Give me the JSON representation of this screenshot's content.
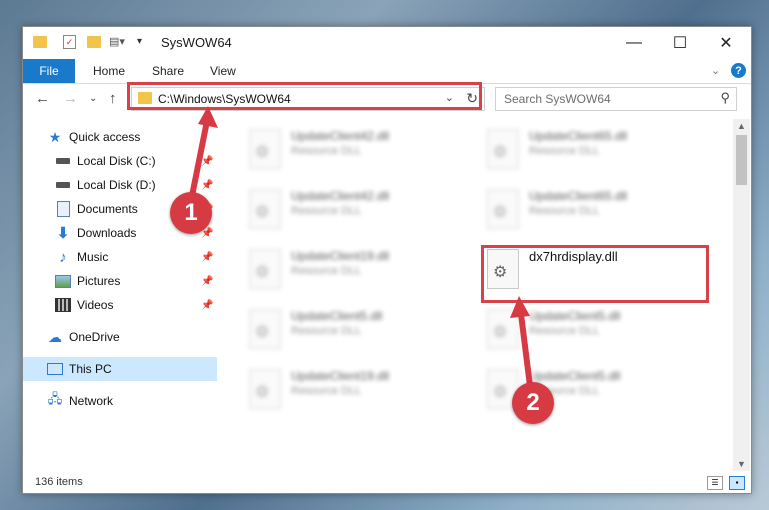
{
  "window": {
    "title": "SysWOW64",
    "controls": {
      "minimize": "—",
      "maximize": "☐",
      "close": "✕"
    }
  },
  "ribbon": {
    "file": "File",
    "tabs": [
      "Home",
      "Share",
      "View"
    ]
  },
  "address": {
    "path": "C:\\Windows\\SysWOW64",
    "search_placeholder": "Search SysWOW64"
  },
  "sidebar": {
    "items": [
      {
        "label": "Quick access",
        "icon": "star-icon"
      },
      {
        "label": "Local Disk (C:)",
        "icon": "drive-icon"
      },
      {
        "label": "Local Disk (D:)",
        "icon": "drive-icon"
      },
      {
        "label": "Documents",
        "icon": "documents-icon"
      },
      {
        "label": "Downloads",
        "icon": "download-icon"
      },
      {
        "label": "Music",
        "icon": "music-icon"
      },
      {
        "label": "Pictures",
        "icon": "pictures-icon"
      },
      {
        "label": "Videos",
        "icon": "videos-icon"
      },
      {
        "label": "OneDrive",
        "icon": "cloud-icon"
      },
      {
        "label": "This PC",
        "icon": "computer-icon"
      },
      {
        "label": "Network",
        "icon": "network-icon"
      }
    ],
    "selected": "This PC"
  },
  "files": {
    "items": [
      {
        "name": "UpdateClient42.dll",
        "desc": "Resource DLL",
        "blurred": true
      },
      {
        "name": "UpdateClient65.dll",
        "desc": "Resource DLL",
        "blurred": true
      },
      {
        "name": "UpdateClient42.dll",
        "desc": "Resource DLL",
        "blurred": true
      },
      {
        "name": "UpdateClient65.dll",
        "desc": "Resource DLL",
        "blurred": true
      },
      {
        "name": "UpdateClient19.dll",
        "desc": "Resource DLL",
        "blurred": true
      },
      {
        "name": "dx7hrdisplay.dll",
        "desc": "",
        "blurred": false
      },
      {
        "name": "UpdateClient5.dll",
        "desc": "Resource DLL",
        "blurred": true
      },
      {
        "name": "UpdateClient5.dll",
        "desc": "Resource DLL",
        "blurred": true
      },
      {
        "name": "UpdateClient19.dll",
        "desc": "Resource DLL",
        "blurred": true
      },
      {
        "name": "UpdateClient5.dll",
        "desc": "Resource DLL",
        "blurred": true
      }
    ]
  },
  "status": {
    "count": "136 items"
  },
  "callouts": {
    "first": "1",
    "second": "2"
  },
  "colors": {
    "accent": "#1979ca",
    "highlight": "#d9414a",
    "selected": "#cce8ff"
  }
}
